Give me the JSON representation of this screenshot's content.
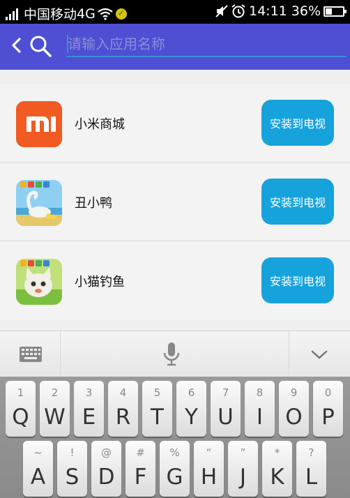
{
  "status_bar": {
    "carrier": "中国移动",
    "network": "4G",
    "time": "14:11",
    "battery": "36%",
    "battery_level": 0.36
  },
  "search": {
    "placeholder": "请输入应用名称",
    "value": ""
  },
  "apps": [
    {
      "name": "小米商城",
      "button": "安装到电视",
      "icon": "mi-store-icon"
    },
    {
      "name": "丑小鸭",
      "button": "安装到电视",
      "icon": "ugly-duckling-icon"
    },
    {
      "name": "小猫钓鱼",
      "button": "安装到电视",
      "icon": "kitten-fishing-icon"
    }
  ],
  "keyboard": {
    "row1": [
      {
        "sub": "1",
        "main": "Q"
      },
      {
        "sub": "2",
        "main": "W"
      },
      {
        "sub": "3",
        "main": "E"
      },
      {
        "sub": "4",
        "main": "R"
      },
      {
        "sub": "5",
        "main": "T"
      },
      {
        "sub": "6",
        "main": "Y"
      },
      {
        "sub": "7",
        "main": "U"
      },
      {
        "sub": "8",
        "main": "I"
      },
      {
        "sub": "9",
        "main": "O"
      },
      {
        "sub": "0",
        "main": "P"
      }
    ],
    "row2": [
      {
        "sub": "~",
        "main": "A"
      },
      {
        "sub": "!",
        "main": "S"
      },
      {
        "sub": "@",
        "main": "D"
      },
      {
        "sub": "#",
        "main": "F"
      },
      {
        "sub": "%",
        "main": "G"
      },
      {
        "sub": "“",
        "main": "H"
      },
      {
        "sub": "”",
        "main": "J"
      },
      {
        "sub": "*",
        "main": "K"
      },
      {
        "sub": "?",
        "main": "L"
      }
    ]
  }
}
